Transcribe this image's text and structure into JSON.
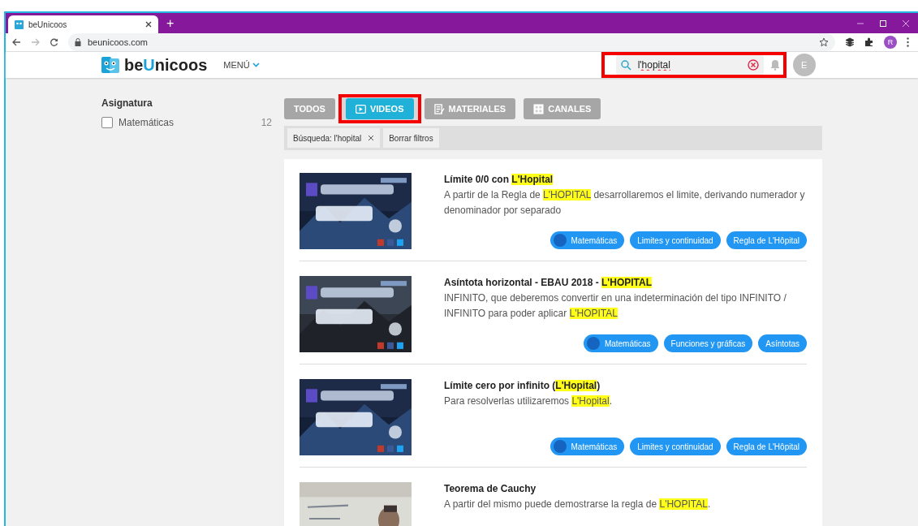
{
  "browser": {
    "tab_title": "beUnicoos",
    "new_tab": "+",
    "url": "beunicoos.com",
    "profile_initial": "R"
  },
  "header": {
    "logo_parts": [
      {
        "text": "be",
        "accent": false
      },
      {
        "text": "U",
        "accent": true
      },
      {
        "text": "nicoos",
        "accent": false
      }
    ],
    "menu": "MENÚ",
    "search": {
      "value": "l'hopital",
      "marked": true
    },
    "avatar": "E"
  },
  "sidebar": {
    "title": "Asignatura",
    "filters": [
      {
        "label": "Matemáticas",
        "count": "12",
        "checked": false
      }
    ]
  },
  "tabs": [
    {
      "label": "TODOS",
      "kind": "all",
      "selected": false,
      "marked": false
    },
    {
      "label": "VIDEOS",
      "kind": "video",
      "selected": true,
      "marked": true
    },
    {
      "label": "MATERIALES",
      "kind": "document",
      "selected": false,
      "marked": false
    },
    {
      "label": "CANALES",
      "kind": "channel",
      "selected": false,
      "marked": false
    }
  ],
  "chips": [
    {
      "label": "Búsqueda: l'hopital",
      "removable": true
    },
    {
      "label": "Borrar filtros",
      "removable": false
    }
  ],
  "results": [
    {
      "title": [
        {
          "text": "Límite 0/0 con ",
          "mark": false
        },
        {
          "text": "L'Hopital",
          "mark": true
        }
      ],
      "description": [
        {
          "text": "A partir de la Regla de ",
          "mark": false
        },
        {
          "text": "L'HOPITAL",
          "mark": true
        },
        {
          "text": " desarrollaremos el limite, derivando numerador y denominador por separado",
          "mark": false
        }
      ],
      "tags": [
        {
          "label": "Matemáticas",
          "kind": "subject"
        },
        {
          "label": "Limites y continuidad",
          "kind": "topic"
        },
        {
          "label": "Regla de L'Hôpital",
          "kind": "topic"
        }
      ]
    },
    {
      "title": [
        {
          "text": "Asíntota horizontal - EBAU 2018 - ",
          "mark": false
        },
        {
          "text": "L'HOPITAL",
          "mark": true
        }
      ],
      "description": [
        {
          "text": "INFINITO, que deberemos convertir en una indeterminación del tipo INFINITO / INFINITO para poder aplicar ",
          "mark": false
        },
        {
          "text": "L'HOPITAL",
          "mark": true
        }
      ],
      "tags": [
        {
          "label": "Matemáticas",
          "kind": "subject"
        },
        {
          "label": "Funciones y gráficas",
          "kind": "topic"
        },
        {
          "label": "Asíntotas",
          "kind": "topic"
        }
      ]
    },
    {
      "title": [
        {
          "text": "Límite cero por infinito (",
          "mark": false
        },
        {
          "text": "L'Hopital",
          "mark": true
        },
        {
          "text": ")",
          "mark": false
        }
      ],
      "description": [
        {
          "text": "Para resolverlas utilizaremos ",
          "mark": false
        },
        {
          "text": "L'Hopital",
          "mark": true
        },
        {
          "text": ".",
          "mark": false
        }
      ],
      "tags": [
        {
          "label": "Matemáticas",
          "kind": "subject"
        },
        {
          "label": "Limites y continuidad",
          "kind": "topic"
        },
        {
          "label": "Regla de L'Hôpital",
          "kind": "topic"
        }
      ]
    },
    {
      "title": [
        {
          "text": "Teorema de Cauchy",
          "mark": false
        }
      ],
      "description": [
        {
          "text": "A partir del mismo puede demostrarse la regla de ",
          "mark": false
        },
        {
          "text": "L'HOPITAL",
          "mark": true
        },
        {
          "text": ".",
          "mark": false
        }
      ]
    }
  ]
}
